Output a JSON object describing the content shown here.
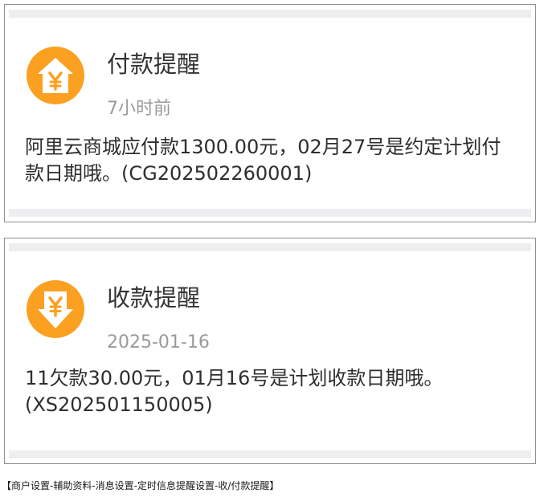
{
  "cards": [
    {
      "icon": "house-yen-icon",
      "title": "付款提醒",
      "time": "7小时前",
      "body": "阿里云商城应付款1300.00元，02月27号是约定计划付款日期哦。(CG202502260001)"
    },
    {
      "icon": "download-yen-icon",
      "title": "收款提醒",
      "time": "2025-01-16",
      "body": "11欠款30.00元，01月16号是计划收款日期哦。(XS202501150005)"
    }
  ],
  "footer": {
    "caption": "【商户设置-辅助资料-消息设置-定时信息提醒设置-收/付款提醒】"
  },
  "colors": {
    "icon_orange": "#fba020",
    "title_text": "#333333",
    "time_text": "#9a9a9a",
    "strip": "#eeeef0"
  }
}
